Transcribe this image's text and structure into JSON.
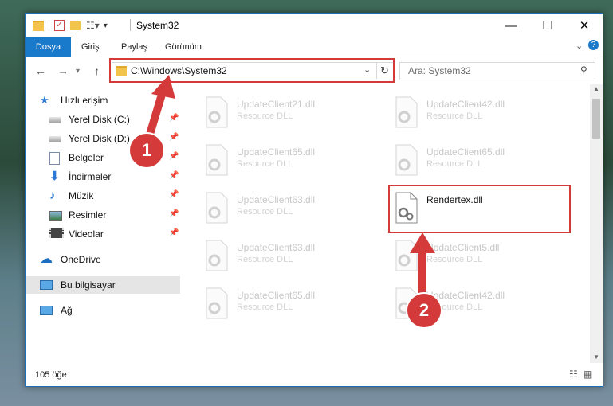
{
  "window": {
    "title": "System32"
  },
  "ribbon": {
    "tabs": [
      "Dosya",
      "Giriş",
      "Paylaş",
      "Görünüm"
    ]
  },
  "address": {
    "path": "C:\\Windows\\System32"
  },
  "search": {
    "placeholder": "Ara: System32"
  },
  "sidebar": {
    "quick_access": "Hızlı erişim",
    "items": [
      "Yerel Disk (C:)",
      "Yerel Disk (D:)",
      "Belgeler",
      "İndirmeler",
      "Müzik",
      "Resimler",
      "Videolar"
    ],
    "onedrive": "OneDrive",
    "this_pc": "Bu bilgisayar",
    "network": "Ağ"
  },
  "files": [
    {
      "name": "UpdateClient21.dll",
      "desc": "Resource DLL"
    },
    {
      "name": "UpdateClient42.dll",
      "desc": "Resource DLL"
    },
    {
      "name": "UpdateClient65.dll",
      "desc": "Resource DLL"
    },
    {
      "name": "UpdateClient65.dll",
      "desc": "Resource DLL"
    },
    {
      "name": "UpdateClient63.dll",
      "desc": "Resource DLL"
    },
    {
      "name": "Rendertex.dll",
      "desc": ""
    },
    {
      "name": "UpdateClient63.dll",
      "desc": "Resource DLL"
    },
    {
      "name": "UpdateClient5.dll",
      "desc": "Resource DLL"
    },
    {
      "name": "UpdateClient65.dll",
      "desc": "Resource DLL"
    },
    {
      "name": "UpdateClient42.dll",
      "desc": "Resource DLL"
    }
  ],
  "status": {
    "count": "105 öğe"
  },
  "annotations": {
    "step1": "1",
    "step2": "2"
  },
  "colors": {
    "accent": "#1979ca",
    "highlight": "#d43a3a"
  }
}
